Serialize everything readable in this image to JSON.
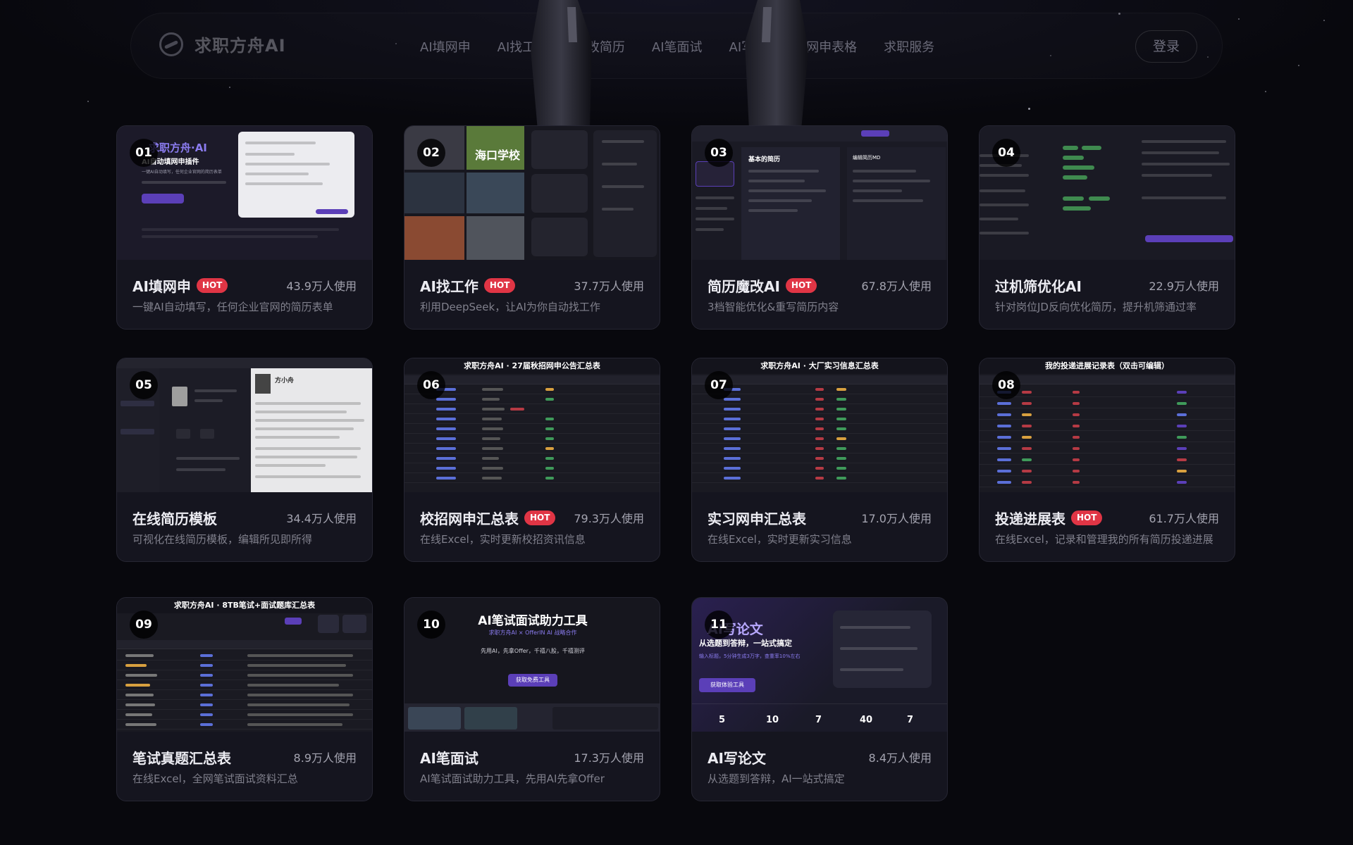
{
  "header": {
    "brand": "求职方舟AI",
    "nav": [
      "AI填网申",
      "AI找工作",
      "AI改简历",
      "AI笔面试",
      "AI写论文",
      "网申表格",
      "求职服务"
    ],
    "login_label": "登录"
  },
  "cards": [
    {
      "num": "01",
      "title": "AI填网申",
      "hot": "HOT",
      "users": "43.9万人使用",
      "desc": "一键AI自动填写，任何企业官网的简历表单",
      "thumb": {
        "heading": "求职方舟·AI",
        "sub": "AI自动填网申插件",
        "note": "一键AI自动填写，任何企业官网的简历表单"
      }
    },
    {
      "num": "02",
      "title": "AI找工作",
      "hot": "HOT",
      "users": "37.7万人使用",
      "desc": "利用DeepSeek，让AI为你自动找工作",
      "thumb": {
        "tag": "海口学校"
      }
    },
    {
      "num": "03",
      "title": "简历魔改AI",
      "hot": "HOT",
      "users": "67.8万人使用",
      "desc": "3档智能优化&重写简历内容",
      "thumb": {
        "left_title": "基本的简历",
        "right_title": "编辑简历MD"
      }
    },
    {
      "num": "04",
      "title": "过机筛优化AI",
      "hot": "",
      "users": "22.9万人使用",
      "desc": "针对岗位JD反向优化简历，提升机筛通过率"
    },
    {
      "num": "05",
      "title": "在线简历模板",
      "hot": "",
      "users": "34.4万人使用",
      "desc": "可视化在线简历模板，编辑所见即所得",
      "thumb": {
        "name": "方小舟"
      }
    },
    {
      "num": "06",
      "title": "校招网申汇总表",
      "hot": "HOT",
      "users": "79.3万人使用",
      "desc": "在线Excel，实时更新校招资讯信息",
      "thumb": {
        "heading": "求职方舟AI · 27届秋招网申公告汇总表"
      }
    },
    {
      "num": "07",
      "title": "实习网申汇总表",
      "hot": "",
      "users": "17.0万人使用",
      "desc": "在线Excel，实时更新实习信息",
      "thumb": {
        "heading": "求职方舟AI · 大厂实习信息汇总表"
      }
    },
    {
      "num": "08",
      "title": "投递进展表",
      "hot": "HOT",
      "users": "61.7万人使用",
      "desc": "在线Excel，记录和管理我的所有简历投递进展",
      "thumb": {
        "heading": "我的投递进展记录表（双击可编辑）"
      }
    },
    {
      "num": "09",
      "title": "笔试真题汇总表",
      "hot": "",
      "users": "8.9万人使用",
      "desc": "在线Excel，全网笔试面试资料汇总",
      "thumb": {
        "heading": "求职方舟AI · 8TB笔试+面试题库汇总表"
      }
    },
    {
      "num": "10",
      "title": "AI笔面试",
      "hot": "",
      "users": "17.3万人使用",
      "desc": "AI笔试面试助力工具，先用AI先拿Offer",
      "thumb": {
        "heading": "AI笔试面试助力工具",
        "sub": "求职方舟AI × OfferIN AI 战略合作",
        "line": "先用AI，先拿Offer，千禧八股，千禧测评",
        "btn": "获取免费工具"
      }
    },
    {
      "num": "11",
      "title": "AI写论文",
      "hot": "",
      "users": "8.4万人使用",
      "desc": "从选题到答辩，AI一站式搞定",
      "thumb": {
        "heading": "AI写论文",
        "sub": "从选题到答辩，一站式搞定",
        "line": "输入标题，5分钟生成3万字，查重率10%左右",
        "btn": "获取体验工具",
        "stats": [
          "5",
          "10",
          "7",
          "40",
          "7"
        ]
      }
    }
  ],
  "colors": {
    "hot": "#e03545",
    "accent": "#5b3fb8",
    "card": "#15151f",
    "bg": "#08080d"
  },
  "icons": {
    "brand": "boat-logo-icon"
  }
}
